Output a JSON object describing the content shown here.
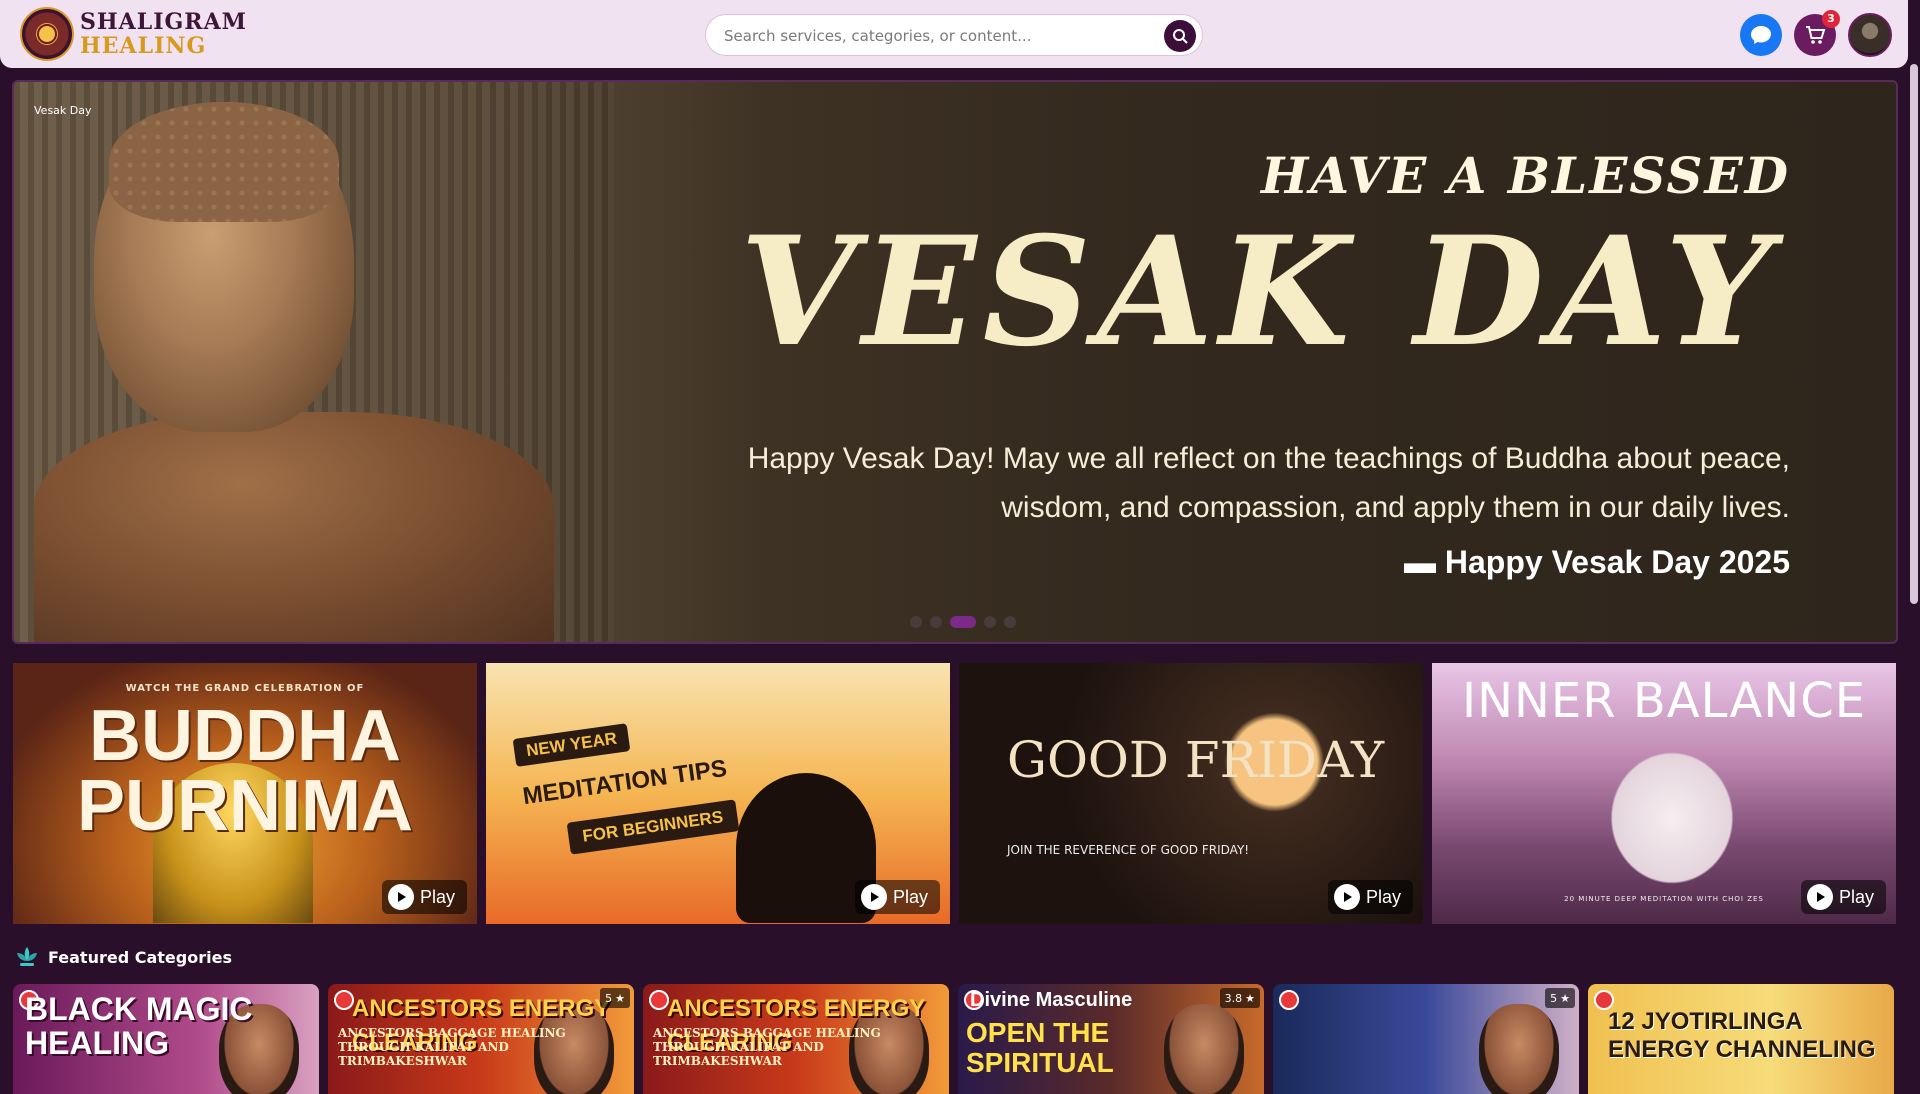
{
  "brand": {
    "line1": "SHALIGRAM",
    "line2": "HEALING"
  },
  "search": {
    "placeholder": "Search services, categories, or content..."
  },
  "header": {
    "cart_count": "3"
  },
  "hero": {
    "label": "Vesak Day",
    "line1": "HAVE A BLESSED",
    "line2": "VESAK DAY",
    "quote": "Happy Vesak Day! May we all reflect on the teachings of Buddha about peace, wisdom, and compassion, and apply them in our daily lives.",
    "signature": "Happy Vesak Day 2025",
    "slides": 5,
    "active_slide": 3
  },
  "videos": [
    {
      "subtitle": "WATCH THE GRAND CELEBRATION OF",
      "title": "BUDDHA PURNIMA",
      "play": "Play"
    },
    {
      "tag1": "NEW YEAR",
      "tag2": "MEDITATION TIPS",
      "tag3": "FOR BEGINNERS",
      "play": "Play"
    },
    {
      "title": "GOOD FRIDAY",
      "subtitle": "JOIN THE REVERENCE OF GOOD FRIDAY!",
      "play": "Play"
    },
    {
      "title": "INNER BALANCE",
      "subtitle": "20 MINUTE DEEP MEDITATION WITH CHOI ZES",
      "play": "Play"
    }
  ],
  "featured": {
    "title": "Featured Categories"
  },
  "categories": [
    {
      "title": "BLACK MAGIC HEALING",
      "rating": ""
    },
    {
      "title": "ANCESTORS ENERGY CLEARING",
      "subtitle": "ANCESTORS BAGGAGE HEALING THROUGH KALIPAT AND TRIMBAKESHWAR",
      "rating": "5"
    },
    {
      "title": "ANCESTORS ENERGY CLEARING",
      "subtitle": "ANCESTORS BAGGAGE HEALING THROUGH KALIPAT AND TRIMBAKESHWAR",
      "rating": ""
    },
    {
      "title": "Divine Masculine",
      "subtitle": "OPEN THE SPIRITUAL",
      "rating": "3.8"
    },
    {
      "title": "",
      "rating": "5"
    },
    {
      "title": "12 JYOTIRLINGA ENERGY CHANNELING",
      "rating": ""
    }
  ],
  "colors": {
    "header_bg": "#f1e2f2",
    "page_bg": "#2a0f2b",
    "accent": "#6b1b5f",
    "chat": "#1877f2",
    "badge": "#e0253b"
  }
}
